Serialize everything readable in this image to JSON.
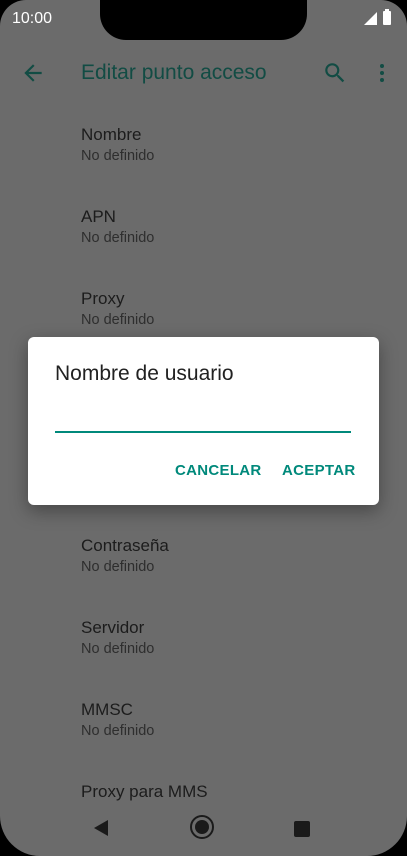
{
  "status_bar": {
    "time": "10:00",
    "icons": [
      "signal-icon",
      "battery-icon"
    ]
  },
  "app_bar": {
    "title": "Editar punto acceso",
    "icons": [
      "back-arrow-icon",
      "search-icon",
      "more-vert-icon"
    ],
    "title_color": "#124c44"
  },
  "settings": {
    "items": [
      {
        "title": "Nombre",
        "summary": "No definido"
      },
      {
        "title": "APN",
        "summary": "No definido"
      },
      {
        "title": "Proxy",
        "summary": "No definido"
      },
      {
        "title": "Contraseña",
        "summary": "No definido"
      },
      {
        "title": "Servidor",
        "summary": "No definido"
      },
      {
        "title": "MMSC",
        "summary": "No definido"
      },
      {
        "title": "Proxy para MMS"
      }
    ]
  },
  "dialog": {
    "title": "Nombre de usuario",
    "input_value": "",
    "cancel_label": "CANCELAR",
    "accept_label": "ACEPTAR",
    "accent_color": "#00897b"
  },
  "nav_bar": {
    "icons": [
      "nav-back-icon",
      "nav-home-icon",
      "nav-recents-icon"
    ]
  }
}
